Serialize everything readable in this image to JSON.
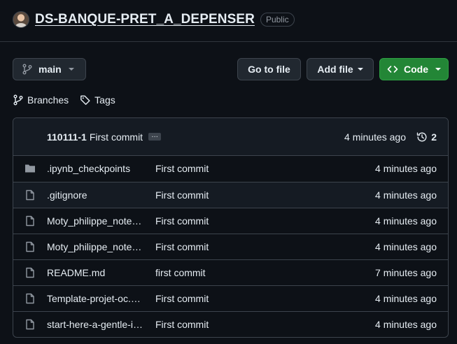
{
  "repo": {
    "name": "DS-BANQUE-PRET_A_DEPENSER",
    "visibility": "Public"
  },
  "toolbar": {
    "branch": "main",
    "go_to_file": "Go to file",
    "add_file": "Add file",
    "code": "Code"
  },
  "links": {
    "branches": "Branches",
    "tags": "Tags"
  },
  "latest_commit": {
    "user": "110111-1",
    "message": "First commit",
    "ellipsis": "…",
    "time": "4 minutes ago",
    "history_count": "2"
  },
  "files": [
    {
      "type": "folder",
      "name": ".ipynb_checkpoints",
      "commit": "First commit",
      "time": "4 minutes ago"
    },
    {
      "type": "file",
      "name": ".gitignore",
      "commit": "First commit",
      "time": "4 minutes ago"
    },
    {
      "type": "file",
      "name": "Moty_philippe_note…",
      "commit": "First commit",
      "time": "4 minutes ago"
    },
    {
      "type": "file",
      "name": "Moty_philippe_note…",
      "commit": "First commit",
      "time": "4 minutes ago"
    },
    {
      "type": "file",
      "name": "README.md",
      "commit": "first commit",
      "time": "7 minutes ago"
    },
    {
      "type": "file",
      "name": "Template-projet-oc.…",
      "commit": "First commit",
      "time": "4 minutes ago"
    },
    {
      "type": "file",
      "name": "start-here-a-gentle-i…",
      "commit": "First commit",
      "time": "4 minutes ago"
    }
  ],
  "colors": {
    "background": "#0d1117",
    "border": "#3d444d",
    "code_button": "#238636",
    "text": "#e6edf3",
    "muted": "#9198a1"
  }
}
